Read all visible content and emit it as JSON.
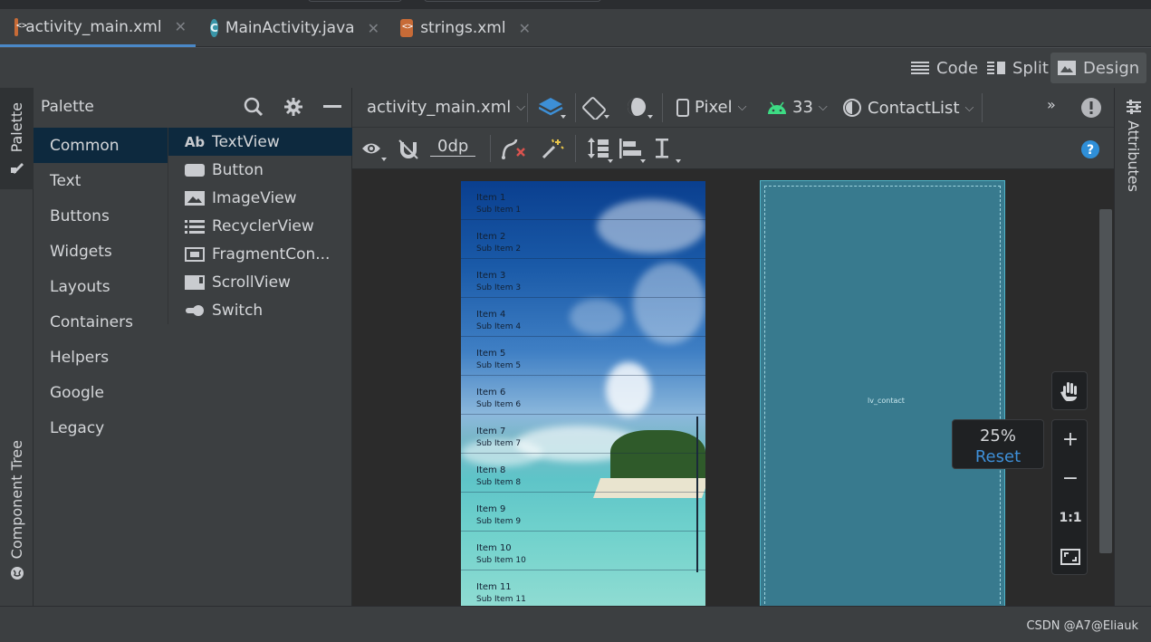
{
  "tabs": [
    {
      "label": "activity_main.xml",
      "icon": "xml-file-icon",
      "active": true
    },
    {
      "label": "MainActivity.java",
      "icon": "java-class-icon",
      "active": false
    },
    {
      "label": "strings.xml",
      "icon": "xml-file-icon",
      "active": false
    }
  ],
  "modes": {
    "code": "Code",
    "split": "Split",
    "design": "Design"
  },
  "left_strip": {
    "palette": "Palette",
    "component_tree": "Component Tree"
  },
  "palette": {
    "title": "Palette",
    "categories": [
      "Common",
      "Text",
      "Buttons",
      "Widgets",
      "Layouts",
      "Containers",
      "Helpers",
      "Google",
      "Legacy"
    ],
    "selected_category": "Common",
    "widgets": [
      {
        "label": "TextView",
        "icon": "textview-icon"
      },
      {
        "label": "Button",
        "icon": "button-icon"
      },
      {
        "label": "ImageView",
        "icon": "imageview-icon"
      },
      {
        "label": "RecyclerView",
        "icon": "recyclerview-icon"
      },
      {
        "label": "FragmentCon...",
        "icon": "fragment-container-icon"
      },
      {
        "label": "ScrollView",
        "icon": "scrollview-icon"
      },
      {
        "label": "Switch",
        "icon": "switch-icon"
      }
    ]
  },
  "toolbar": {
    "file": "activity_main.xml",
    "device": "Pixel",
    "api": "33",
    "theme": "ContactList",
    "margin": "0dp",
    "more": "»"
  },
  "list_items": [
    {
      "title": "Item 1",
      "sub": "Sub Item 1"
    },
    {
      "title": "Item 2",
      "sub": "Sub Item 2"
    },
    {
      "title": "Item 3",
      "sub": "Sub Item 3"
    },
    {
      "title": "Item 4",
      "sub": "Sub Item 4"
    },
    {
      "title": "Item 5",
      "sub": "Sub Item 5"
    },
    {
      "title": "Item 6",
      "sub": "Sub Item 6"
    },
    {
      "title": "Item 7",
      "sub": "Sub Item 7"
    },
    {
      "title": "Item 8",
      "sub": "Sub Item 8"
    },
    {
      "title": "Item 9",
      "sub": "Sub Item 9"
    },
    {
      "title": "Item 10",
      "sub": "Sub Item 10"
    },
    {
      "title": "Item 11",
      "sub": "Sub Item 11"
    }
  ],
  "blueprint": {
    "label": "lv_contact"
  },
  "zoom": {
    "value": "25%",
    "reset": "Reset",
    "one_to_one": "1:1"
  },
  "right_strip": {
    "attributes": "Attributes"
  },
  "status": {
    "watermark": "CSDN @A7@Eliauk"
  },
  "colors": {
    "accent": "#4a88c7",
    "selection": "#0d293e",
    "link": "#3e8fd8",
    "blueprint": "#387a8e"
  }
}
